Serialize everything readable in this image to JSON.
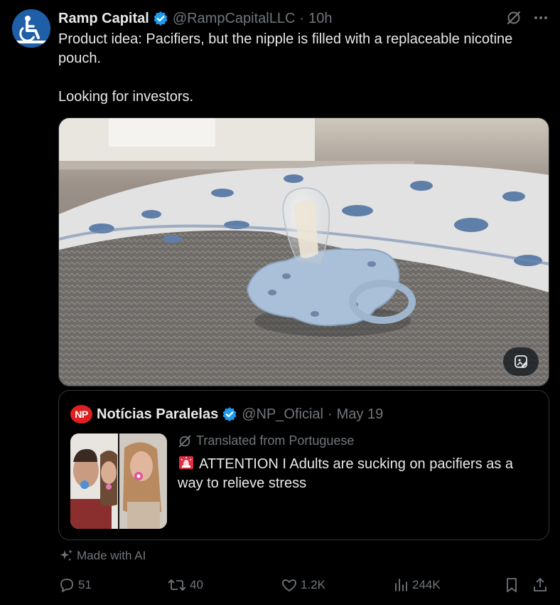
{
  "tweet": {
    "author": {
      "display_name": "Ramp Capital",
      "handle": "@RampCapitalLLC",
      "time": "10h",
      "avatar_icon": "wheelchair-icon",
      "verified_icon": "verified-badge-icon"
    },
    "text_lines": [
      "Product idea: Pacifiers, but the nipple is filled with a replaceable nicotine pouch.",
      "Looking for investors."
    ],
    "top_icons": [
      "grok-icon",
      "more-icon"
    ],
    "media": {
      "description_icon": "edit-image-icon"
    },
    "quote": {
      "badge": "NP",
      "display_name": "Notícias Paralelas",
      "handle": "@NP_Oficial",
      "time": "May 19",
      "translated_label": "Translated from Portuguese",
      "text": "ATTENTION I Adults are sucking on pacifiers as a way to relieve stress",
      "alarm_icon": "siren-emoji-icon"
    },
    "ai_label": "Made with AI",
    "actions": {
      "replies": "51",
      "reposts": "40",
      "likes": "1.2K",
      "views": "244K"
    }
  },
  "colors": {
    "background": "#000000",
    "text": "#e7e9ea",
    "muted": "#71767b",
    "verified": "#1d9bf0",
    "border": "#2f3336",
    "np_red": "#e02020"
  }
}
